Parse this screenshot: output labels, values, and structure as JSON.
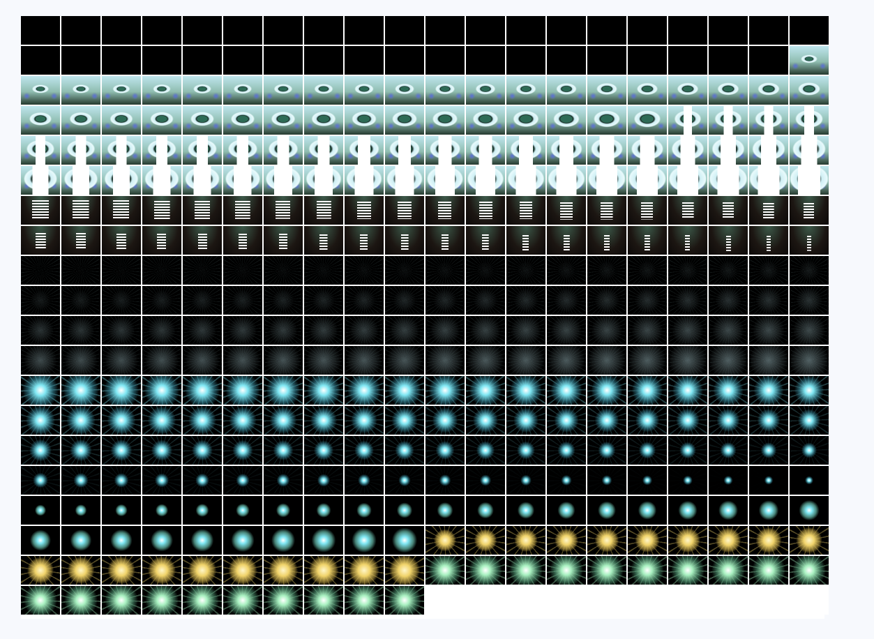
{
  "sheet": {
    "columns": 20,
    "rows": 20,
    "frame_count": 390,
    "background_color": "#000000",
    "gutter_color": "#ffffff",
    "canvas_color": "#f7f9fd"
  },
  "animation": {
    "stages": [
      {
        "name": "blank",
        "frames": 39
      },
      {
        "name": "portal-zoom",
        "frames": 81
      },
      {
        "name": "stair-descent",
        "frames": 40
      },
      {
        "name": "dark-vortex",
        "frames": 80
      },
      {
        "name": "cyan-burst",
        "frames": 80
      },
      {
        "name": "cyan-glow-grow",
        "frames": 30
      },
      {
        "name": "golden-burst",
        "frames": 20
      },
      {
        "name": "green-sparkle",
        "frames": 20
      }
    ],
    "colors": {
      "portal_cyan": "#cfeff4",
      "portal_teal": "#2e6b56",
      "portal_blue": "#5a6fd8",
      "stair_white": "#ffffff",
      "vortex_gray": "#3b4a4e",
      "burst_cyan": "#7fe6f2",
      "burst_gold": "#f0d36a",
      "burst_green": "#a8f0c0"
    }
  }
}
